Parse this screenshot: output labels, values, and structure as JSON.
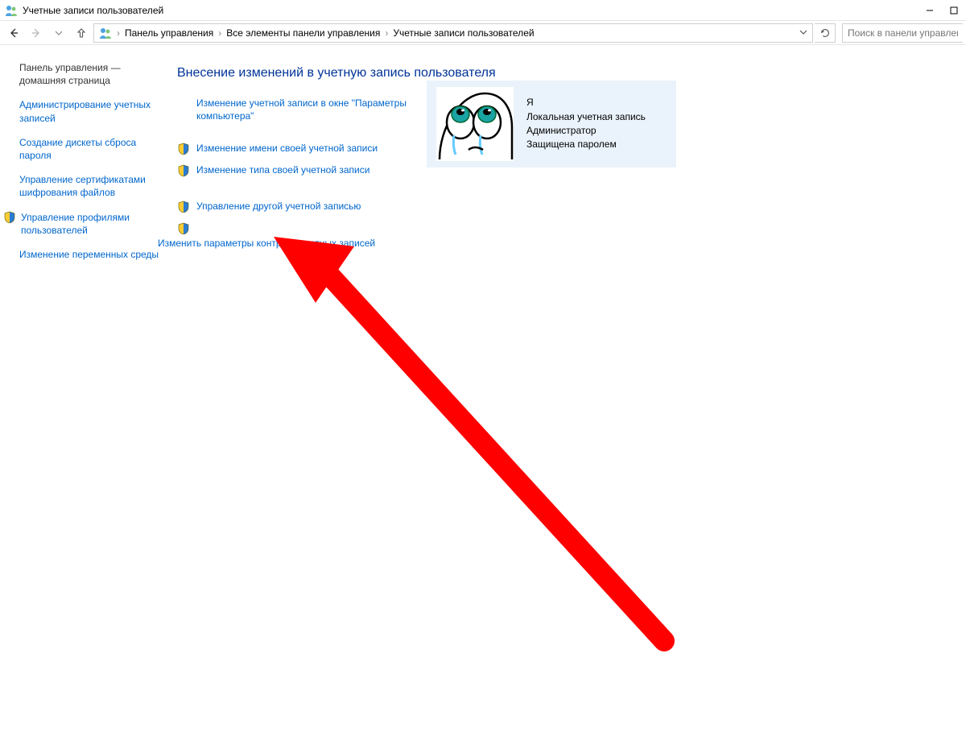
{
  "window": {
    "title": "Учетные записи пользователей"
  },
  "breadcrumb": {
    "seg1": "Панель управления",
    "seg2": "Все элементы панели управления",
    "seg3": "Учетные записи пользователей"
  },
  "search": {
    "placeholder": "Поиск в панели управлен"
  },
  "sidebar": {
    "home": "Панель управления — домашняя страница",
    "items": [
      "Администрирование учетных записей",
      "Создание дискеты сброса пароля",
      "Управление сертификатами шифрования файлов",
      "Управление профилями пользователей",
      "Изменение переменных среды"
    ]
  },
  "main": {
    "heading": "Внесение изменений в учетную запись пользователя",
    "tasks": {
      "change_in_settings": "Изменение учетной записи в окне \"Параметры компьютера\"",
      "change_name": "Изменение имени своей учетной записи",
      "change_type": "Изменение типа своей учетной записи",
      "manage_other": "Управление другой учетной записью",
      "change_uac": "Изменить параметры контроля учетных записей"
    }
  },
  "account": {
    "name": "Я",
    "type": "Локальная учетная запись",
    "role": "Администратор",
    "protection": "Защищена паролем"
  }
}
